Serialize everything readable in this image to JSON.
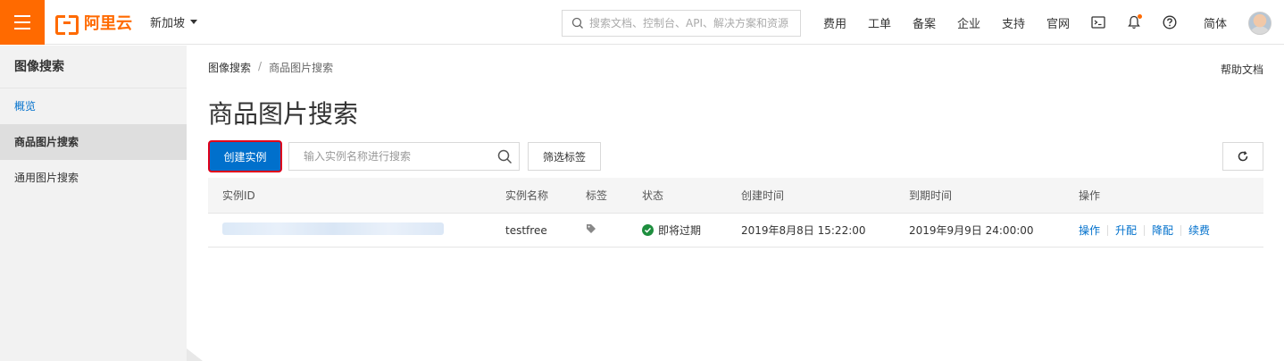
{
  "header": {
    "logo_text": "阿里云",
    "region": "新加坡",
    "search_placeholder": "搜索文档、控制台、API、解决方案和资源",
    "nav": [
      "费用",
      "工单",
      "备案",
      "企业",
      "支持",
      "官网"
    ],
    "language": "简体",
    "icons": [
      "terminal-icon",
      "bell-icon",
      "help-circle-icon"
    ],
    "accent_color": "#ff6a00"
  },
  "sidebar": {
    "title": "图像搜索",
    "items": [
      {
        "label": "概览"
      },
      {
        "label": "商品图片搜索"
      },
      {
        "label": "通用图片搜索"
      }
    ]
  },
  "breadcrumb": [
    "图像搜索",
    "/",
    "商品图片搜索"
  ],
  "help_link": "帮助文档",
  "page_title": "商品图片搜索",
  "toolbar": {
    "create_label": "创建实例",
    "search_placeholder": "输入实例名称进行搜索",
    "filter_label": "筛选标签"
  },
  "table": {
    "headers": [
      "实例ID",
      "实例名称",
      "标签",
      "状态",
      "创建时间",
      "到期时间",
      "操作"
    ],
    "rows": [
      {
        "name": "testfree",
        "status": "即将过期",
        "created": "2019年8月8日 15:22:00",
        "expires": "2019年9月9日 24:00:00",
        "actions": [
          "操作",
          "升配",
          "降配",
          "续费"
        ]
      }
    ]
  },
  "colors": {
    "primary": "#0070cc",
    "status_ok": "#1e8e3e",
    "highlight_border": "#e0001a"
  }
}
